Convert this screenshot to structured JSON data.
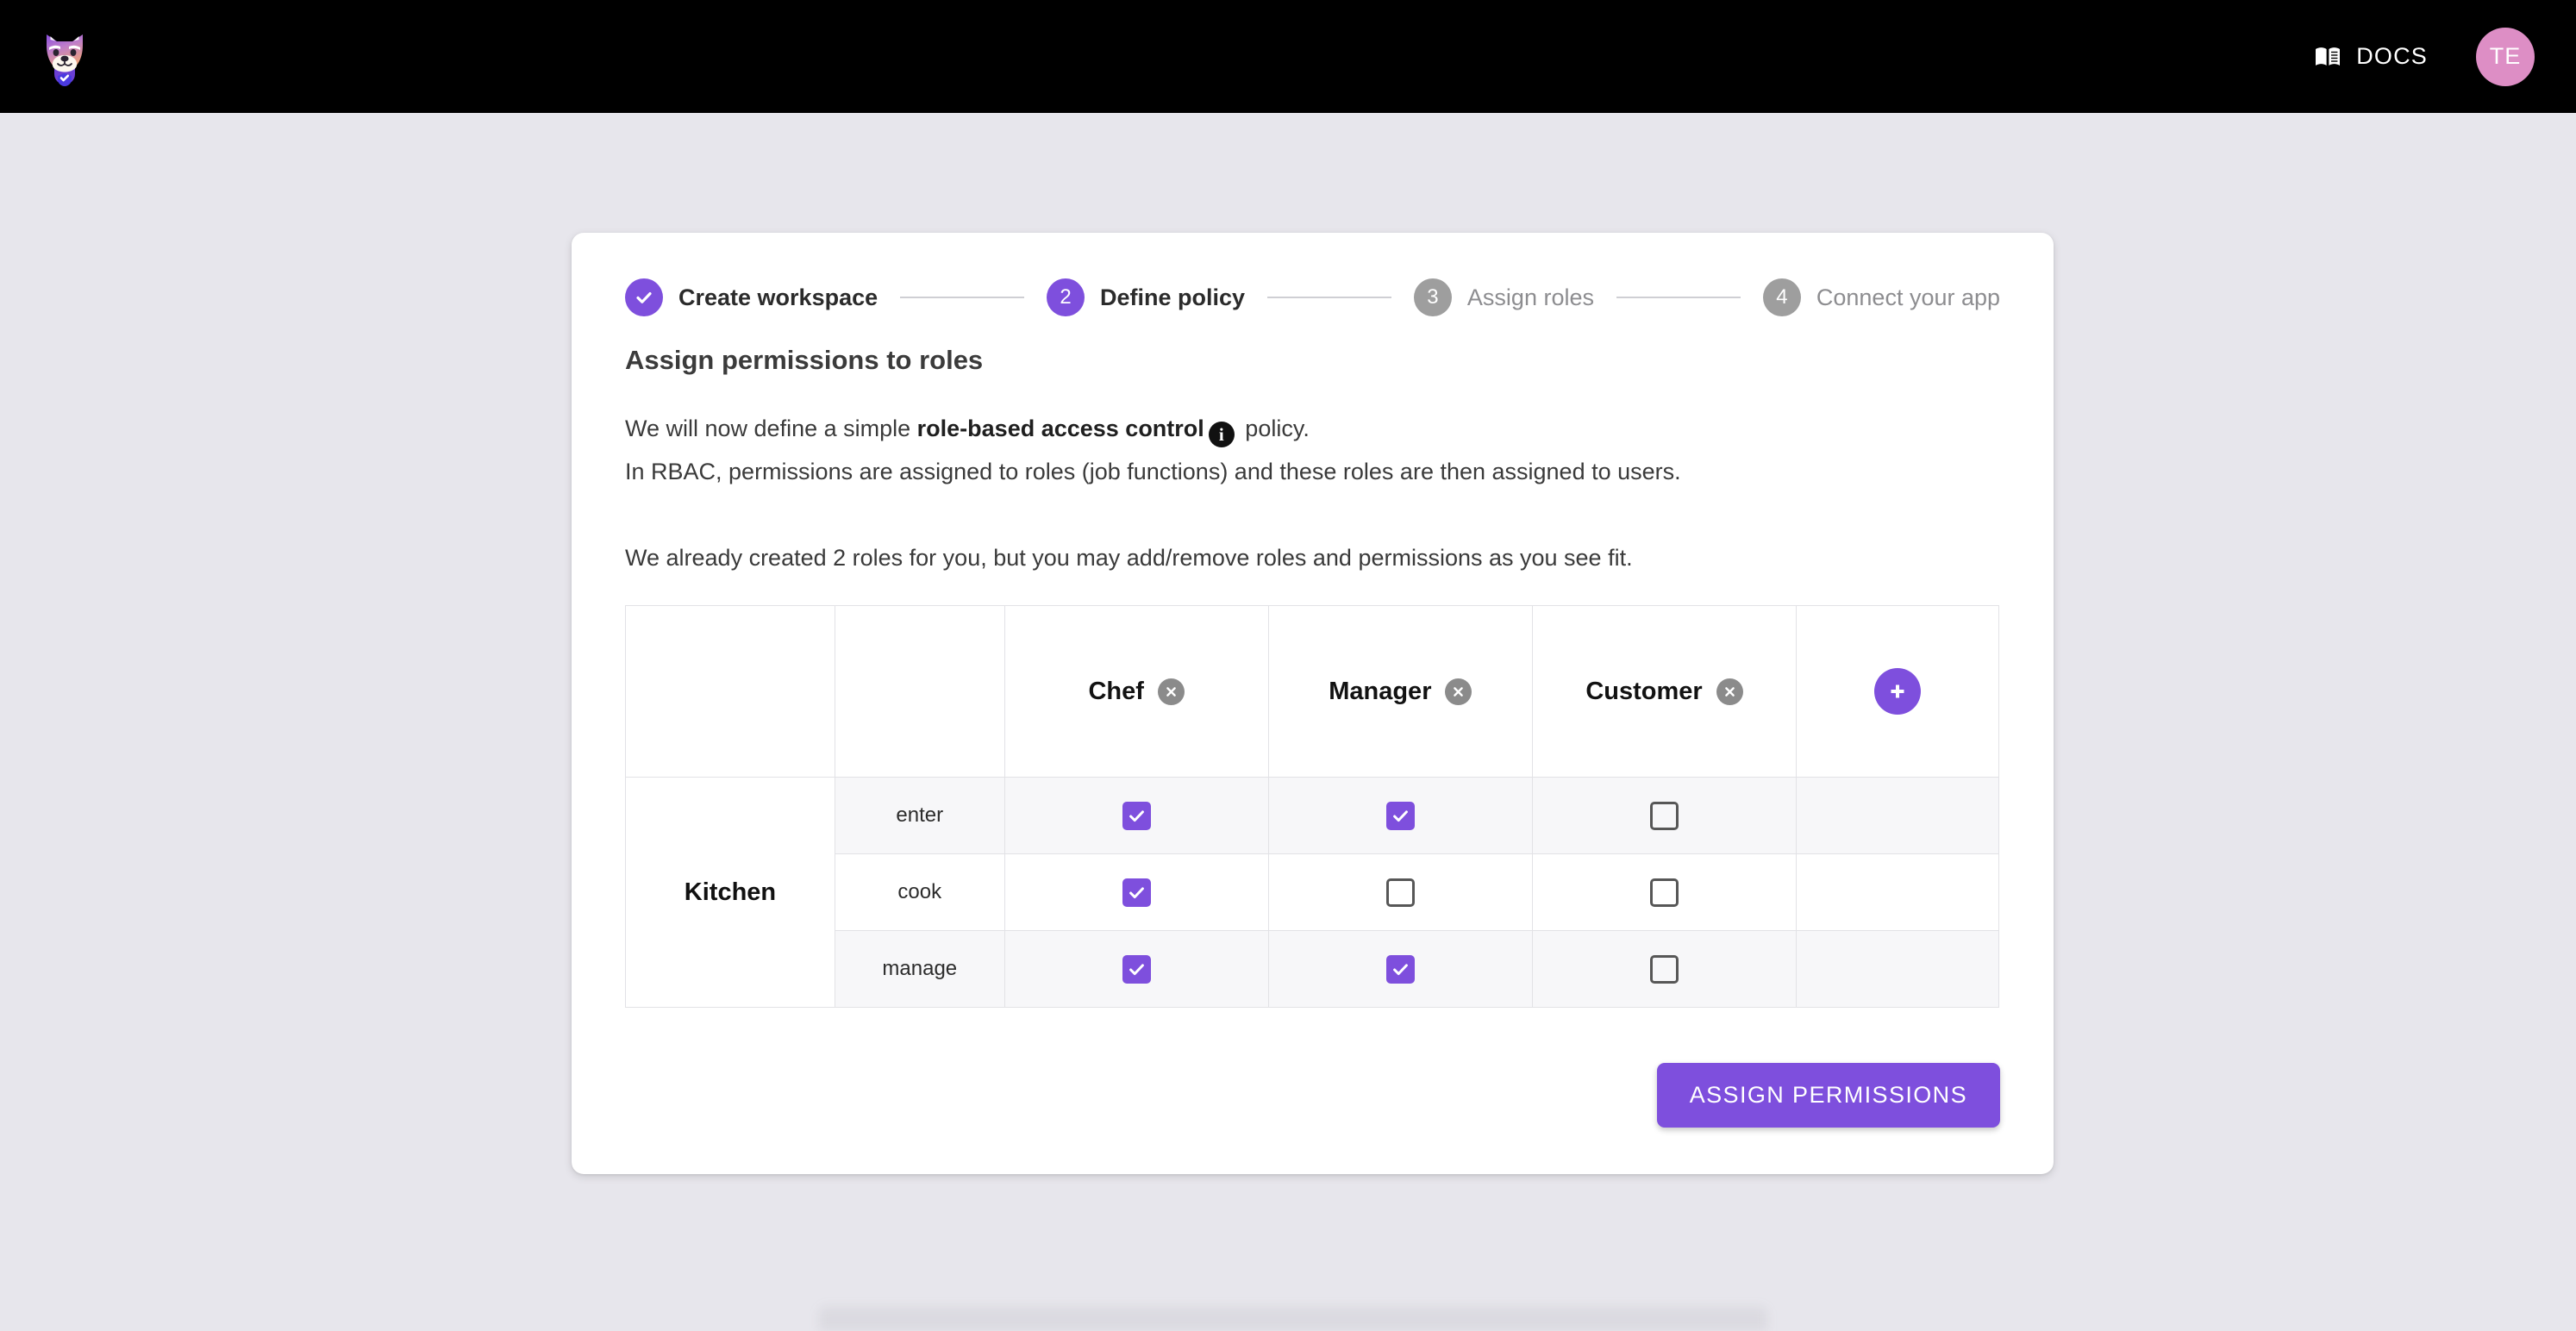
{
  "theme": {
    "accent": "#7e4fdd",
    "page_bg": "#e7e6ec",
    "topbar_bg": "#000000",
    "avatar_bg": "#dd8ec5",
    "muted_gray": "#9e9e9e",
    "row_shade": "#f7f7f9"
  },
  "topbar": {
    "logo_icon": "shiba-dog-logo-icon",
    "docs_label": "DOCS",
    "docs_icon": "book-icon",
    "avatar_initials": "TE"
  },
  "stepper": {
    "steps": [
      {
        "number": "1",
        "glyph": "check",
        "label": "Create workspace",
        "state": "done"
      },
      {
        "number": "2",
        "glyph": "2",
        "label": "Define policy",
        "state": "active"
      },
      {
        "number": "3",
        "glyph": "3",
        "label": "Assign roles",
        "state": "todo"
      },
      {
        "number": "4",
        "glyph": "4",
        "label": "Connect your app",
        "state": "todo"
      }
    ]
  },
  "main": {
    "title": "Assign permissions to roles",
    "paragraph1_pre": "We will now define a simple ",
    "paragraph1_bold": "role-based access control",
    "paragraph1_info_icon": "info-icon",
    "paragraph1_post": " policy.",
    "paragraph2": "In RBAC, permissions are assigned to roles (job functions) and these roles are then assigned to users.",
    "paragraph3": "We already created 2 roles for you, but you may add/remove roles and permissions as you see fit.",
    "submit_label": "ASSIGN PERMISSIONS"
  },
  "matrix": {
    "resource_col_header": "",
    "permission_col_header": "",
    "roles": [
      {
        "name": "Chef",
        "remove_icon": "close-circle-icon"
      },
      {
        "name": "Manager",
        "remove_icon": "close-circle-icon"
      },
      {
        "name": "Customer",
        "remove_icon": "close-circle-icon"
      }
    ],
    "add_role_icon": "plus-icon",
    "resource": "Kitchen",
    "permissions": [
      "enter",
      "cook",
      "manage"
    ],
    "grid": [
      [
        true,
        true,
        false
      ],
      [
        true,
        false,
        false
      ],
      [
        true,
        true,
        false
      ]
    ]
  }
}
